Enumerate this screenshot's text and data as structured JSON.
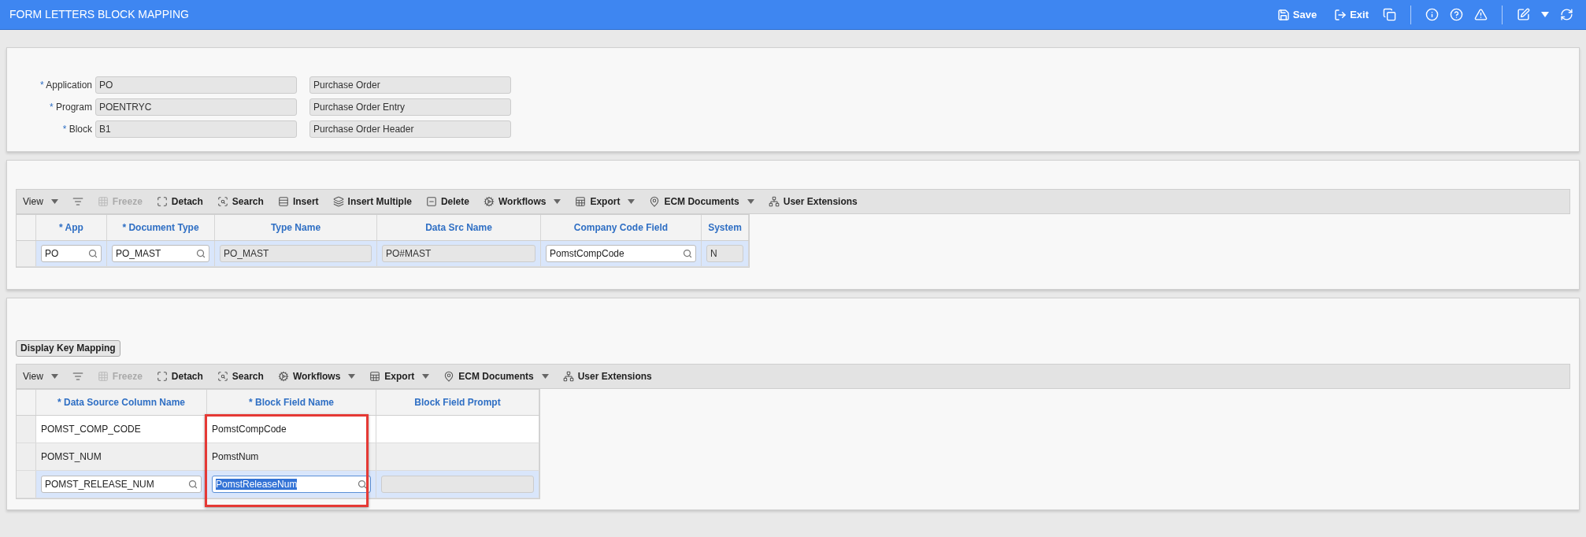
{
  "header": {
    "title": "FORM LETTERS BLOCK MAPPING",
    "actions": [
      {
        "kind": "save",
        "label": "Save"
      },
      {
        "kind": "exit",
        "label": "Exit"
      },
      {
        "kind": "copy"
      },
      {
        "kind": "divider"
      },
      {
        "kind": "info"
      },
      {
        "kind": "help"
      },
      {
        "kind": "warning"
      },
      {
        "kind": "divider"
      },
      {
        "kind": "edit"
      },
      {
        "kind": "caret"
      },
      {
        "kind": "refresh"
      }
    ]
  },
  "form": {
    "fields": [
      {
        "label": "Application",
        "required_mark": "*",
        "value": "PO",
        "description": "Purchase Order"
      },
      {
        "label": "Program",
        "required_mark": "*",
        "value": "POENTRYC",
        "description": "Purchase Order Entry"
      },
      {
        "label": "Block",
        "required_mark": "*",
        "value": "B1",
        "description": "Purchase Order Header"
      }
    ]
  },
  "document_grid": {
    "toolbar": [
      {
        "kind": "view",
        "label": "View",
        "disabled": false
      },
      {
        "kind": "caret"
      },
      {
        "kind": "filter",
        "disabled": false
      },
      {
        "kind": "freeze",
        "label": "Freeze",
        "disabled": true
      },
      {
        "kind": "detach",
        "label": "Detach",
        "disabled": false
      },
      {
        "kind": "search",
        "label": "Search",
        "disabled": false
      },
      {
        "kind": "insert",
        "label": "Insert",
        "disabled": false
      },
      {
        "kind": "insert_multiple",
        "label": "Insert Multiple",
        "disabled": false
      },
      {
        "kind": "delete",
        "label": "Delete",
        "disabled": false
      },
      {
        "kind": "workflows",
        "label": "Workflows",
        "disabled": false
      },
      {
        "kind": "caret"
      },
      {
        "kind": "export",
        "label": "Export",
        "disabled": false
      },
      {
        "kind": "caret"
      },
      {
        "kind": "ecm",
        "label": "ECM Documents",
        "disabled": false
      },
      {
        "kind": "caret"
      },
      {
        "kind": "extensions",
        "label": "User Extensions",
        "disabled": false
      }
    ],
    "columns": [
      {
        "label": "App",
        "required_mark": "*"
      },
      {
        "label": "Document Type",
        "required_mark": "*"
      },
      {
        "label": "Type Name"
      },
      {
        "label": "Data Src Name"
      },
      {
        "label": "Company Code Field"
      },
      {
        "label": "System"
      }
    ],
    "rows": [
      {
        "selected": true,
        "cells": [
          {
            "kind": "lookup",
            "value": "PO"
          },
          {
            "kind": "lookup",
            "value": "PO_MAST"
          },
          {
            "kind": "readonly",
            "value": "PO_MAST"
          },
          {
            "kind": "readonly",
            "value": "PO#MAST"
          },
          {
            "kind": "lookup",
            "value": "PomstCompCode"
          },
          {
            "kind": "readonly",
            "value": "N"
          }
        ]
      }
    ]
  },
  "mapping_grid": {
    "button": "Display Key Mapping",
    "toolbar": [
      {
        "kind": "view",
        "label": "View",
        "disabled": false
      },
      {
        "kind": "caret"
      },
      {
        "kind": "filter",
        "disabled": false
      },
      {
        "kind": "freeze",
        "label": "Freeze",
        "disabled": true
      },
      {
        "kind": "detach",
        "label": "Detach",
        "disabled": false
      },
      {
        "kind": "search",
        "label": "Search",
        "disabled": false
      },
      {
        "kind": "workflows",
        "label": "Workflows",
        "disabled": false
      },
      {
        "kind": "caret"
      },
      {
        "kind": "export",
        "label": "Export",
        "disabled": false
      },
      {
        "kind": "caret"
      },
      {
        "kind": "ecm",
        "label": "ECM Documents",
        "disabled": false
      },
      {
        "kind": "caret"
      },
      {
        "kind": "extensions",
        "label": "User Extensions",
        "disabled": false
      }
    ],
    "columns": [
      {
        "label": "Data Source Column Name",
        "required_mark": "*"
      },
      {
        "label": "Block Field Name",
        "required_mark": "*"
      },
      {
        "label": "Block Field Prompt"
      }
    ],
    "rows": [
      {
        "selected": false,
        "cells": [
          {
            "kind": "text",
            "value": "POMST_COMP_CODE"
          },
          {
            "kind": "text",
            "value": "PomstCompCode"
          },
          {
            "kind": "text"
          }
        ]
      },
      {
        "selected": false,
        "cells": [
          {
            "kind": "text",
            "value": "POMST_NUM"
          },
          {
            "kind": "text",
            "value": "PomstNum"
          },
          {
            "kind": "text"
          }
        ]
      },
      {
        "selected": true,
        "cells": [
          {
            "kind": "lookup",
            "value": "POMST_RELEASE_NUM",
            "highlighted": false
          },
          {
            "kind": "lookup",
            "value": "PomstReleaseNum",
            "highlighted": true
          },
          {
            "kind": "readonly"
          }
        ]
      }
    ]
  }
}
